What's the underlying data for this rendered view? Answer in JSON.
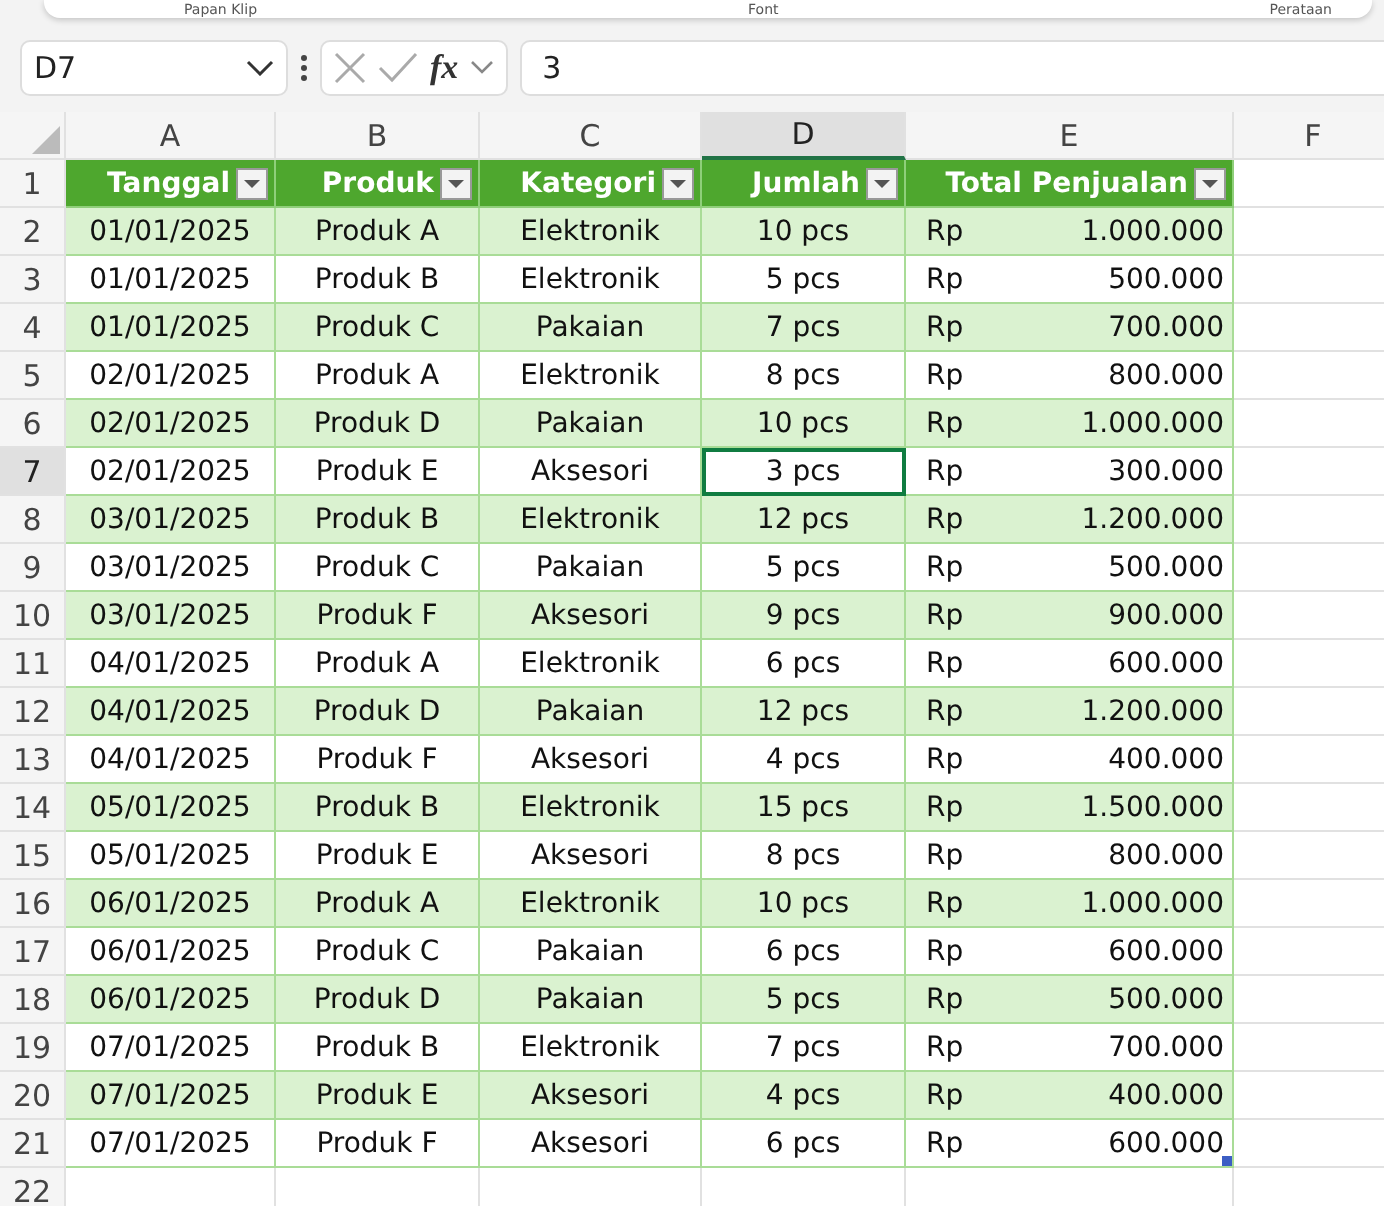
{
  "ribbon_groups": [
    "Papan Klip",
    "Font",
    "Perataan"
  ],
  "formula_bar": {
    "name_box": "D7",
    "fx": "fx",
    "value": "3"
  },
  "columns": [
    {
      "label": "A",
      "selected": false
    },
    {
      "label": "B",
      "selected": false
    },
    {
      "label": "C",
      "selected": false
    },
    {
      "label": "D",
      "selected": true
    },
    {
      "label": "E",
      "selected": false
    },
    {
      "label": "F",
      "selected": false
    }
  ],
  "headers": [
    "Tanggal",
    "Produk",
    "Kategori",
    "Jumlah",
    "Total Penjualan"
  ],
  "rows": [
    {
      "n": "2",
      "tanggal": "01/01/2025",
      "produk": "Produk A",
      "kategori": "Elektronik",
      "jumlah": "10 pcs",
      "currency": "Rp",
      "total": "1.000.000",
      "selected": false
    },
    {
      "n": "3",
      "tanggal": "01/01/2025",
      "produk": "Produk B",
      "kategori": "Elektronik",
      "jumlah": "5 pcs",
      "currency": "Rp",
      "total": "500.000",
      "selected": false
    },
    {
      "n": "4",
      "tanggal": "01/01/2025",
      "produk": "Produk C",
      "kategori": "Pakaian",
      "jumlah": "7 pcs",
      "currency": "Rp",
      "total": "700.000",
      "selected": false
    },
    {
      "n": "5",
      "tanggal": "02/01/2025",
      "produk": "Produk A",
      "kategori": "Elektronik",
      "jumlah": "8 pcs",
      "currency": "Rp",
      "total": "800.000",
      "selected": false
    },
    {
      "n": "6",
      "tanggal": "02/01/2025",
      "produk": "Produk D",
      "kategori": "Pakaian",
      "jumlah": "10 pcs",
      "currency": "Rp",
      "total": "1.000.000",
      "selected": false
    },
    {
      "n": "7",
      "tanggal": "02/01/2025",
      "produk": "Produk E",
      "kategori": "Aksesori",
      "jumlah": "3 pcs",
      "currency": "Rp",
      "total": "300.000",
      "selected": true
    },
    {
      "n": "8",
      "tanggal": "03/01/2025",
      "produk": "Produk B",
      "kategori": "Elektronik",
      "jumlah": "12 pcs",
      "currency": "Rp",
      "total": "1.200.000",
      "selected": false
    },
    {
      "n": "9",
      "tanggal": "03/01/2025",
      "produk": "Produk C",
      "kategori": "Pakaian",
      "jumlah": "5 pcs",
      "currency": "Rp",
      "total": "500.000",
      "selected": false
    },
    {
      "n": "10",
      "tanggal": "03/01/2025",
      "produk": "Produk F",
      "kategori": "Aksesori",
      "jumlah": "9 pcs",
      "currency": "Rp",
      "total": "900.000",
      "selected": false
    },
    {
      "n": "11",
      "tanggal": "04/01/2025",
      "produk": "Produk A",
      "kategori": "Elektronik",
      "jumlah": "6 pcs",
      "currency": "Rp",
      "total": "600.000",
      "selected": false
    },
    {
      "n": "12",
      "tanggal": "04/01/2025",
      "produk": "Produk D",
      "kategori": "Pakaian",
      "jumlah": "12 pcs",
      "currency": "Rp",
      "total": "1.200.000",
      "selected": false
    },
    {
      "n": "13",
      "tanggal": "04/01/2025",
      "produk": "Produk F",
      "kategori": "Aksesori",
      "jumlah": "4 pcs",
      "currency": "Rp",
      "total": "400.000",
      "selected": false
    },
    {
      "n": "14",
      "tanggal": "05/01/2025",
      "produk": "Produk B",
      "kategori": "Elektronik",
      "jumlah": "15 pcs",
      "currency": "Rp",
      "total": "1.500.000",
      "selected": false
    },
    {
      "n": "15",
      "tanggal": "05/01/2025",
      "produk": "Produk E",
      "kategori": "Aksesori",
      "jumlah": "8 pcs",
      "currency": "Rp",
      "total": "800.000",
      "selected": false
    },
    {
      "n": "16",
      "tanggal": "06/01/2025",
      "produk": "Produk A",
      "kategori": "Elektronik",
      "jumlah": "10 pcs",
      "currency": "Rp",
      "total": "1.000.000",
      "selected": false
    },
    {
      "n": "17",
      "tanggal": "06/01/2025",
      "produk": "Produk C",
      "kategori": "Pakaian",
      "jumlah": "6 pcs",
      "currency": "Rp",
      "total": "600.000",
      "selected": false
    },
    {
      "n": "18",
      "tanggal": "06/01/2025",
      "produk": "Produk D",
      "kategori": "Pakaian",
      "jumlah": "5 pcs",
      "currency": "Rp",
      "total": "500.000",
      "selected": false
    },
    {
      "n": "19",
      "tanggal": "07/01/2025",
      "produk": "Produk B",
      "kategori": "Elektronik",
      "jumlah": "7 pcs",
      "currency": "Rp",
      "total": "700.000",
      "selected": false
    },
    {
      "n": "20",
      "tanggal": "07/01/2025",
      "produk": "Produk E",
      "kategori": "Aksesori",
      "jumlah": "4 pcs",
      "currency": "Rp",
      "total": "400.000",
      "selected": false
    },
    {
      "n": "21",
      "tanggal": "07/01/2025",
      "produk": "Produk F",
      "kategori": "Aksesori",
      "jumlah": "6 pcs",
      "currency": "Rp",
      "total": "600.000",
      "selected": false
    }
  ],
  "header_row_number": "1",
  "empty_row_number": "22"
}
